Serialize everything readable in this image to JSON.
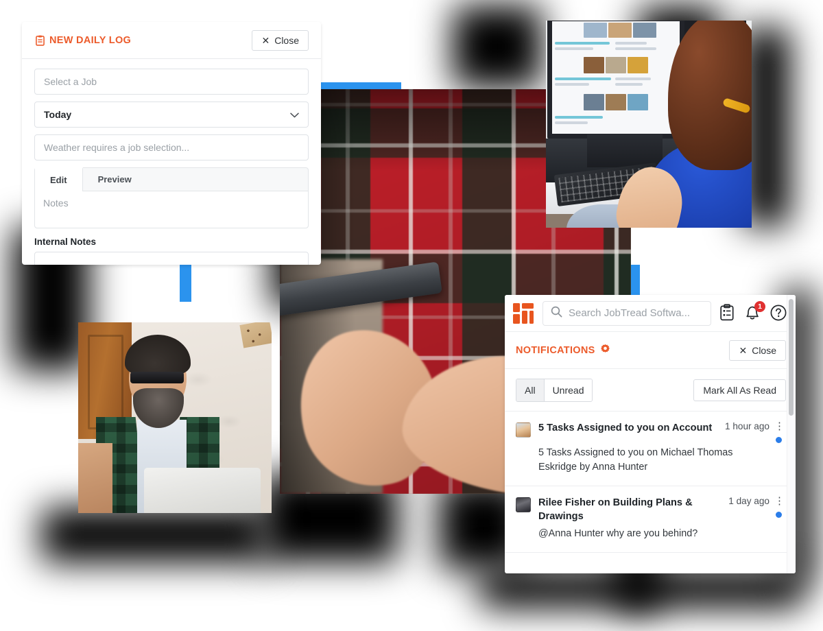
{
  "daily_log": {
    "title": "NEW DAILY LOG",
    "title_icon": "clipboard-icon",
    "close_label": "Close",
    "close_icon": "close-x-icon",
    "job_placeholder": "Select a Job",
    "date_value": "Today",
    "date_chevron_icon": "chevron-down-icon",
    "weather_placeholder": "Weather requires a job selection...",
    "tabs": [
      {
        "label": "Edit",
        "active": true
      },
      {
        "label": "Preview",
        "active": false
      }
    ],
    "notes_placeholder": "Notes",
    "internal_notes_label": "Internal Notes"
  },
  "notifications": {
    "search_placeholder": "Search JobTread Softwa...",
    "search_icon": "search-icon",
    "logo_name": "jobtread-logo",
    "tasks_icon": "clipboard-list-icon",
    "bell_icon": "bell-icon",
    "bell_badge": "1",
    "help_icon": "help-circle-icon",
    "panel_title": "NOTIFICATIONS",
    "settings_icon": "gear-icon",
    "close_label": "Close",
    "close_icon": "close-x-icon",
    "filters": [
      {
        "label": "All",
        "active": true
      },
      {
        "label": "Unread",
        "active": false
      }
    ],
    "mark_all_label": "Mark All As Read",
    "items": [
      {
        "title": "5 Tasks Assigned to you on Account",
        "time": "1 hour ago",
        "body": "5 Tasks Assigned to you on Michael Thomas Eskridge by Anna Hunter",
        "unread": true,
        "menu_icon": "kebab-menu-icon"
      },
      {
        "title": "Rilee Fisher on Building Plans & Drawings",
        "time": "1 day ago",
        "body": "@Anna Hunter why are you behind?",
        "unread": true,
        "menu_icon": "kebab-menu-icon"
      }
    ]
  },
  "colors": {
    "brand_orange": "#ec5b2b",
    "accent_blue": "#2b93ee",
    "unread_blue": "#2b7de9",
    "badge_red": "#e03131"
  },
  "photos": [
    {
      "name": "man-in-plaid-shirt-using-phone"
    },
    {
      "name": "woman-at-desk-using-computer"
    },
    {
      "name": "bearded-man-with-laptop"
    }
  ]
}
